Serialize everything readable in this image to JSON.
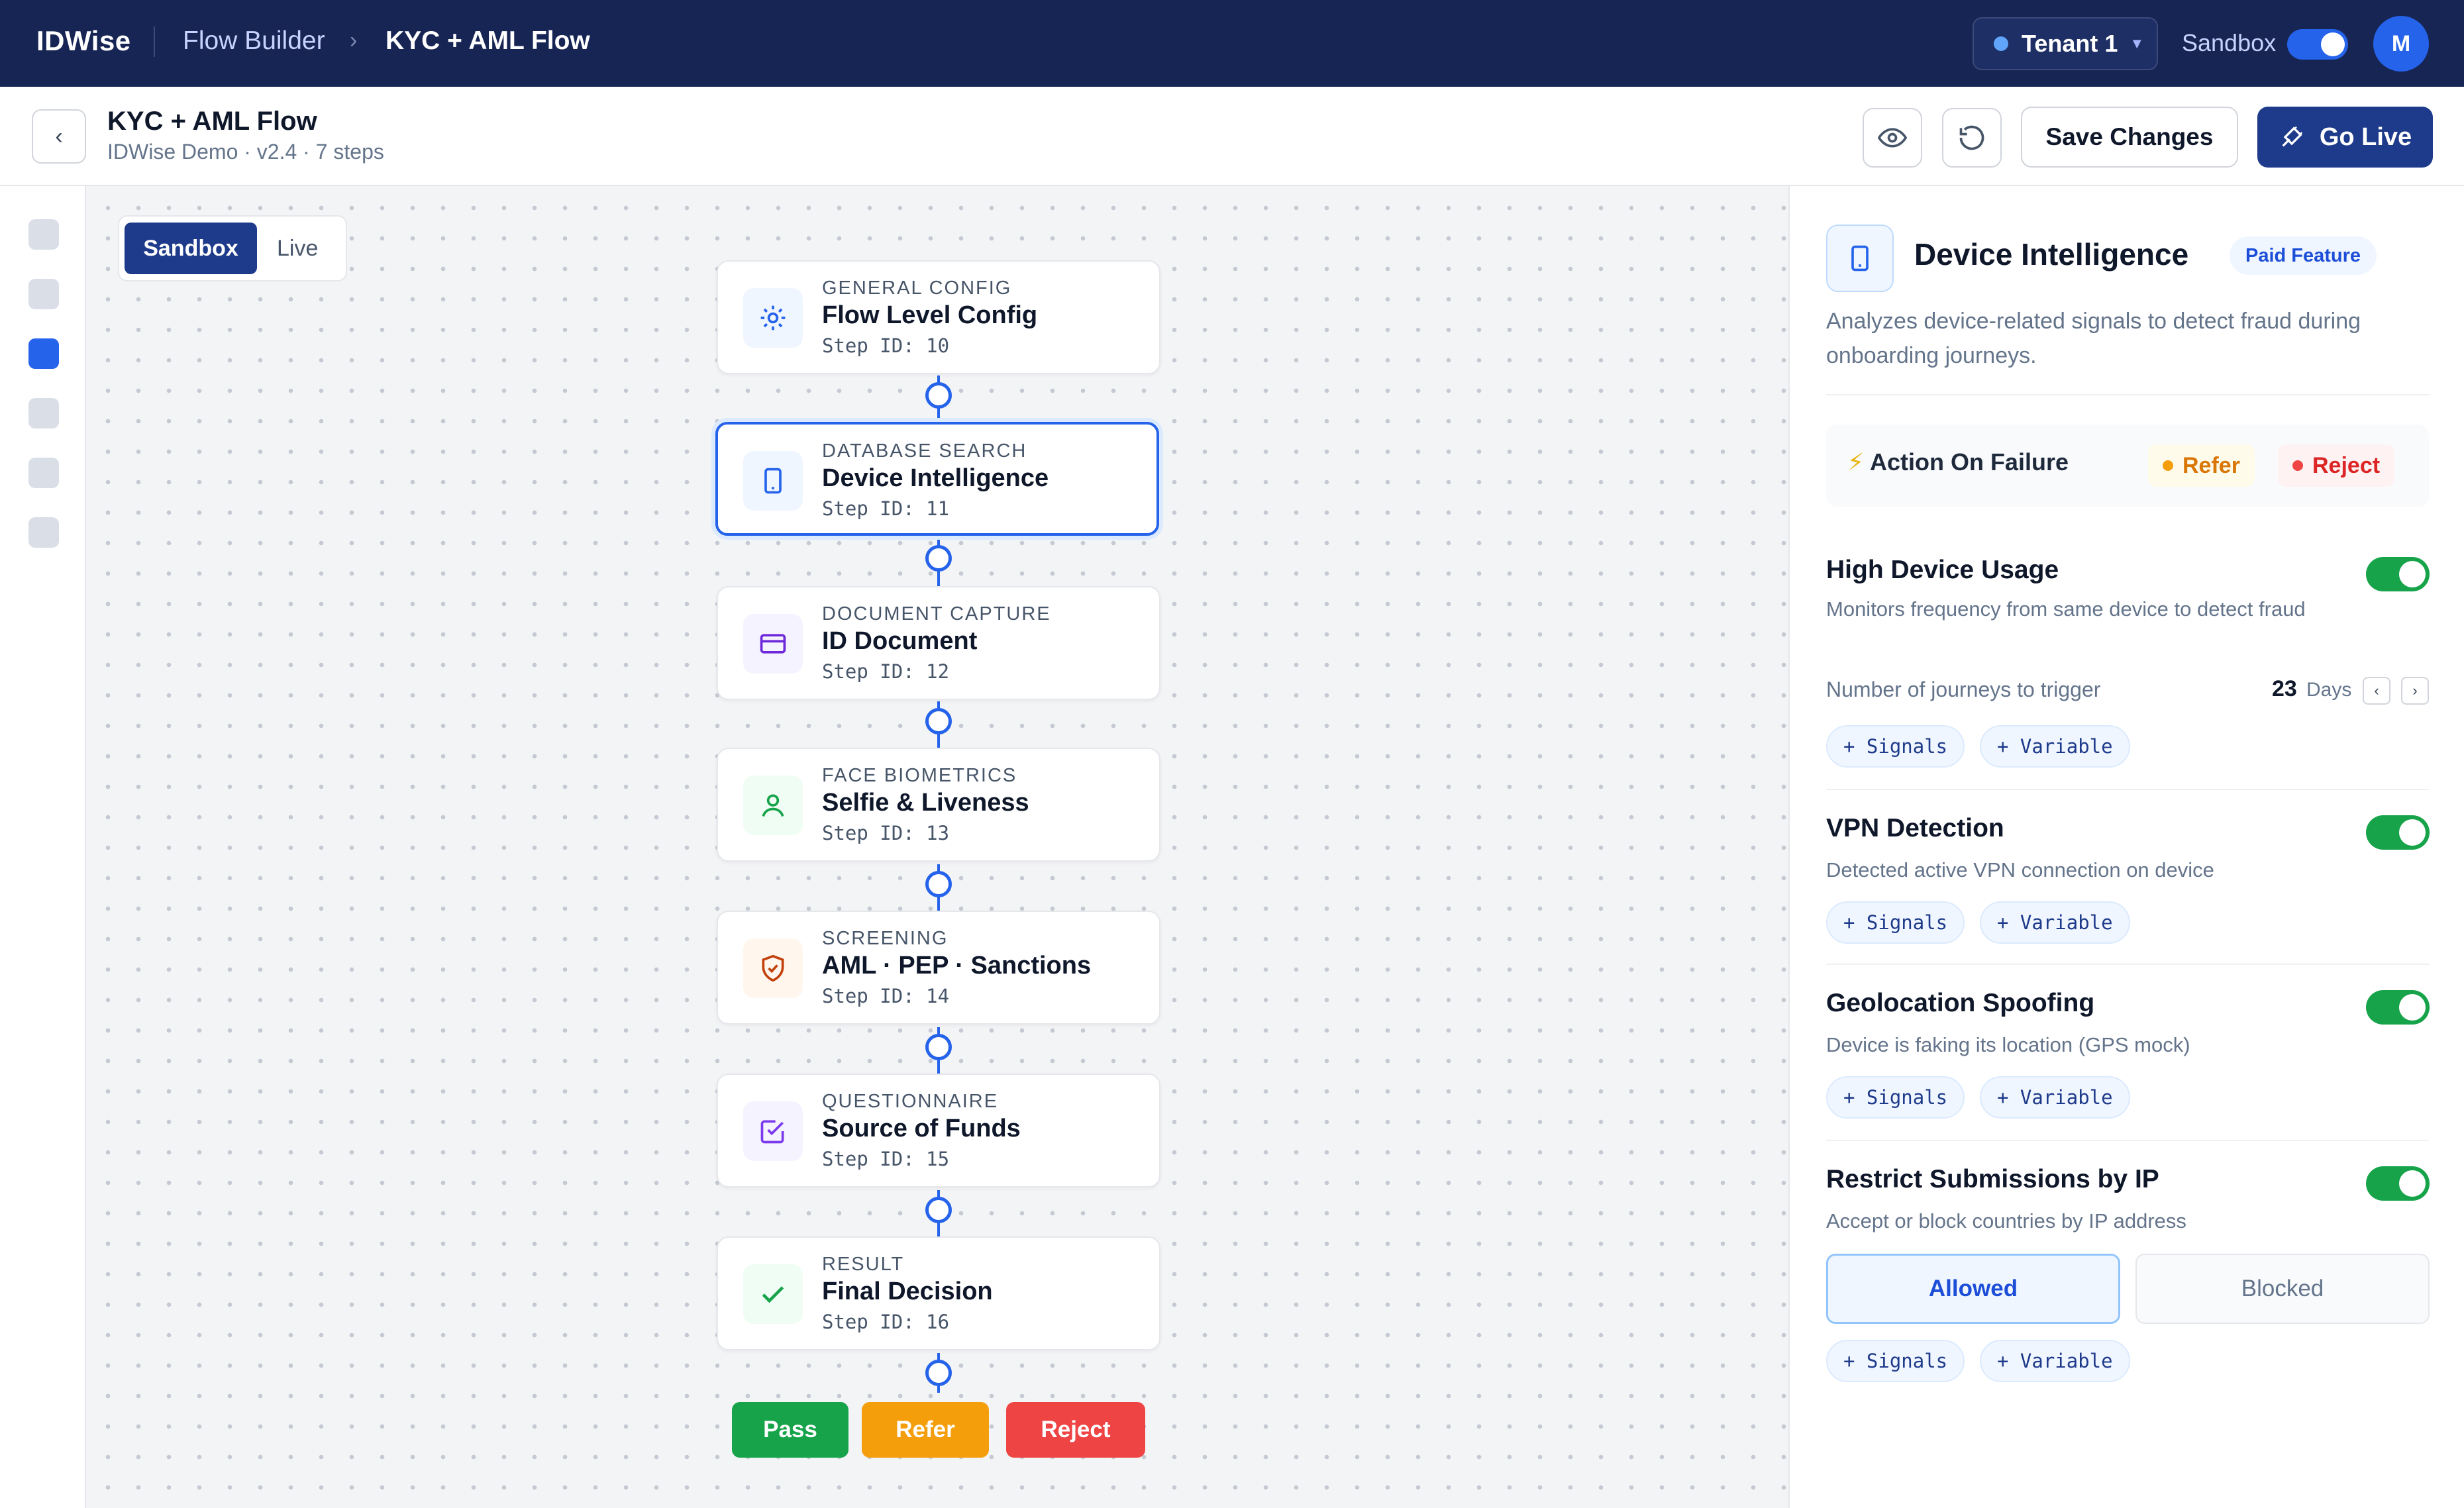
{
  "topbar": {
    "brand": "IDWise",
    "crumb_parent": "Flow Builder",
    "crumb_current": "KYC + AML Flow",
    "tenant": "Tenant 1",
    "sandbox_label": "Sandbox",
    "sandbox_on": true,
    "avatar_initial": "M"
  },
  "subheader": {
    "title": "KYC + AML Flow",
    "subtitle": "IDWise Demo · v2.4 · 7 steps",
    "save_label": "Save Changes",
    "live_label": "Go Live"
  },
  "canvas": {
    "env_options": [
      "Sandbox",
      "Live"
    ],
    "env_selected": "Sandbox",
    "nodes": [
      {
        "category": "GENERAL CONFIG",
        "title": "Flow Level Config",
        "step": "Step ID: 10",
        "icon": "gear-icon"
      },
      {
        "category": "DATABASE SEARCH",
        "title": "Device Intelligence",
        "step": "Step ID: 11",
        "icon": "device-icon"
      },
      {
        "category": "DOCUMENT CAPTURE",
        "title": "ID Document",
        "step": "Step ID: 12",
        "icon": "card-icon"
      },
      {
        "category": "FACE BIOMETRICS",
        "title": "Selfie & Liveness",
        "step": "Step ID: 13",
        "icon": "person-icon"
      },
      {
        "category": "SCREENING",
        "title": "AML · PEP · Sanctions",
        "step": "Step ID: 14",
        "icon": "shield-icon"
      },
      {
        "category": "QUESTIONNAIRE",
        "title": "Source of Funds",
        "step": "Step ID: 15",
        "icon": "checkbox-icon"
      },
      {
        "category": "RESULT",
        "title": "Final Decision",
        "step": "Step ID: 16",
        "icon": "check-icon"
      }
    ],
    "outcomes": [
      "Pass",
      "Refer",
      "Reject"
    ]
  },
  "panel": {
    "title": "Device Intelligence",
    "badge": "Paid Feature",
    "description": "Analyzes device-related signals to detect fraud during onboarding journeys.",
    "action_on_failure": {
      "icon": "⚡",
      "label": "Action On Failure",
      "refer": "Refer",
      "reject": "Reject"
    },
    "signals_label": "+ Signals",
    "variable_label": "+ Variable",
    "sections": [
      {
        "title": "High Device Usage",
        "desc": "Monitors frequency from same device to detect fraud",
        "enabled": true,
        "row_label": "Number of journeys to trigger",
        "value": "23",
        "unit": "Days"
      },
      {
        "title": "VPN Detection",
        "desc": "Detected active VPN connection on device",
        "enabled": true
      },
      {
        "title": "Geolocation Spoofing",
        "desc": "Device is faking its location (GPS mock)",
        "enabled": true
      },
      {
        "title": "Restrict Submissions by IP",
        "desc": "Accept or block countries by IP address",
        "enabled": true,
        "options": [
          "Allowed",
          "Blocked"
        ],
        "selected": "Allowed"
      }
    ]
  },
  "colors": {
    "topbar": "#172554",
    "primary": "#1e3a8a",
    "accent": "#2563eb",
    "toggle_on": "#16a34a",
    "pass": "#16a34a",
    "refer": "#f59e0b",
    "reject": "#ef4444"
  }
}
